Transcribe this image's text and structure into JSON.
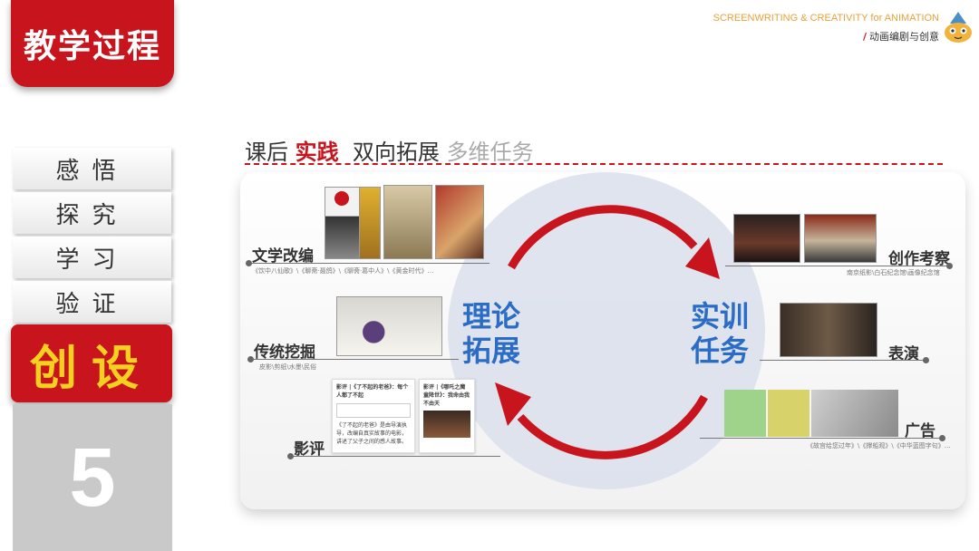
{
  "header": {
    "title": "教学过程"
  },
  "brand": {
    "en": "SCREENWRITING & CREATIVITY for ANIMATION",
    "cn_slash": "/",
    "cn": "动画编剧与创意"
  },
  "menu": {
    "items": [
      "感悟",
      "探究",
      "学习",
      "验证"
    ],
    "active": "创设",
    "number": "5"
  },
  "section_title": {
    "part1": "课后",
    "part2": "实践",
    "part3": "双向拓展",
    "part4": "多维任务"
  },
  "center": {
    "left_line1": "理论",
    "left_line2": "拓展",
    "right_line1": "实训",
    "right_line2": "任务"
  },
  "left_branches": [
    {
      "label": "文学改编",
      "sub": "《饮中八仙歌》\\《聊斋·聂鸽》\\《聊斋·葛中人》\\《黄金时代》…"
    },
    {
      "label": "传统挖掘",
      "sub": "皮影\\剪纸\\水墨\\民俗"
    },
    {
      "label": "影评",
      "sub": ""
    }
  ],
  "right_branches": [
    {
      "label": "创作考察",
      "sub": "南京纸影\\白石纪念馆\\画像纪念馆"
    },
    {
      "label": "表演",
      "sub": ""
    },
    {
      "label": "广告",
      "sub": "《故宫给您过年》\\《撑船观》\\《中华蓝图字句》…"
    }
  ],
  "cards": [
    {
      "title": "影评 |《了不起的老爸》：每个人都了不起",
      "body": "《了不起的老爸》是由导演执导，改编自真实故事的电影，讲述了父子之间的感人故事。"
    },
    {
      "title": "影评 |《哪吒之魔童降世》：我命由我不由天",
      "body": ""
    }
  ],
  "colors": {
    "red": "#c8141c",
    "blue": "#2b6cc4",
    "yellow": "#f5d020",
    "gray": "#c9c9c9"
  }
}
